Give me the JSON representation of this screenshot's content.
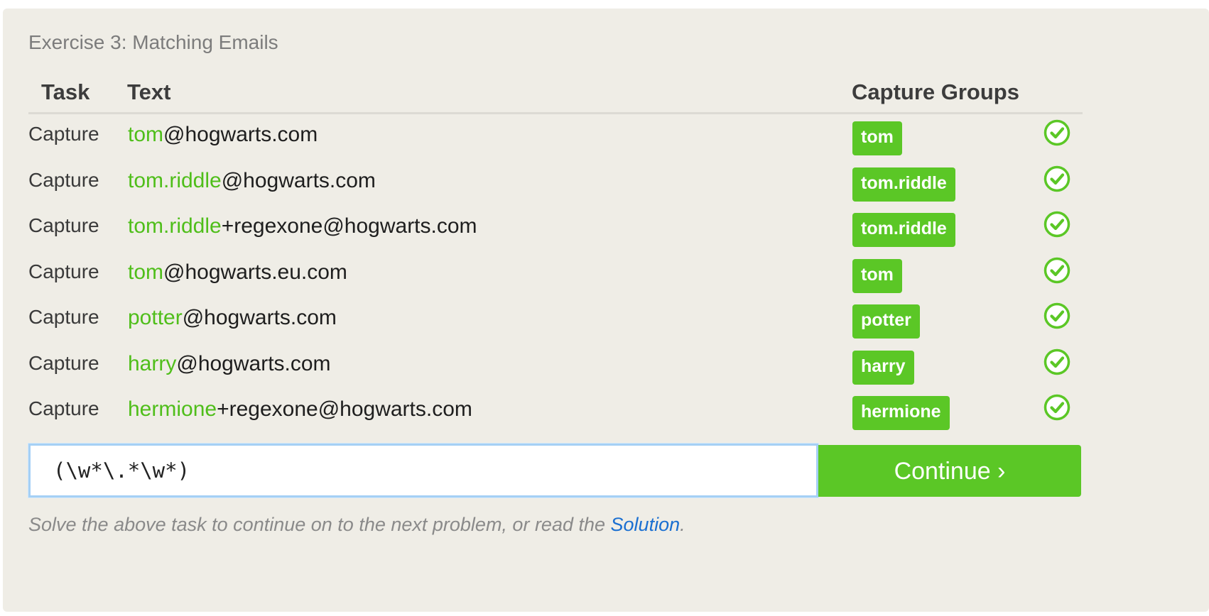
{
  "exercise_title": "Exercise 3: Matching Emails",
  "headers": {
    "task": "Task",
    "text": "Text",
    "capture_groups": "Capture Groups"
  },
  "rows": [
    {
      "task": "Capture",
      "match": "tom",
      "rest": "@hogwarts.com",
      "group": "tom",
      "status": "check-circle-icon"
    },
    {
      "task": "Capture",
      "match": "tom.riddle",
      "rest": "@hogwarts.com",
      "group": "tom.riddle",
      "status": "check-circle-icon"
    },
    {
      "task": "Capture",
      "match": "tom.riddle",
      "rest": "+regexone@hogwarts.com",
      "group": "tom.riddle",
      "status": "check-circle-icon"
    },
    {
      "task": "Capture",
      "match": "tom",
      "rest": "@hogwarts.eu.com",
      "group": "tom",
      "status": "check-circle-icon"
    },
    {
      "task": "Capture",
      "match": "potter",
      "rest": "@hogwarts.com",
      "group": "potter",
      "status": "check-circle-icon"
    },
    {
      "task": "Capture",
      "match": "harry",
      "rest": "@hogwarts.com",
      "group": "harry",
      "status": "check-circle-icon"
    },
    {
      "task": "Capture",
      "match": "hermione",
      "rest": "+regexone@hogwarts.com",
      "group": "hermione",
      "status": "check-circle-icon"
    }
  ],
  "regex_input": {
    "value": "(\\w*\\.*\\w*)"
  },
  "continue_button": {
    "label": "Continue ›"
  },
  "footer": {
    "text": "Solve the above task to continue on to the next problem, or read the ",
    "link": "Solution",
    "end": "."
  },
  "colors": {
    "accent_green": "#5bc726",
    "match_green": "#4fbe1a",
    "link_blue": "#1a6fd1",
    "panel_bg": "#efede6"
  }
}
